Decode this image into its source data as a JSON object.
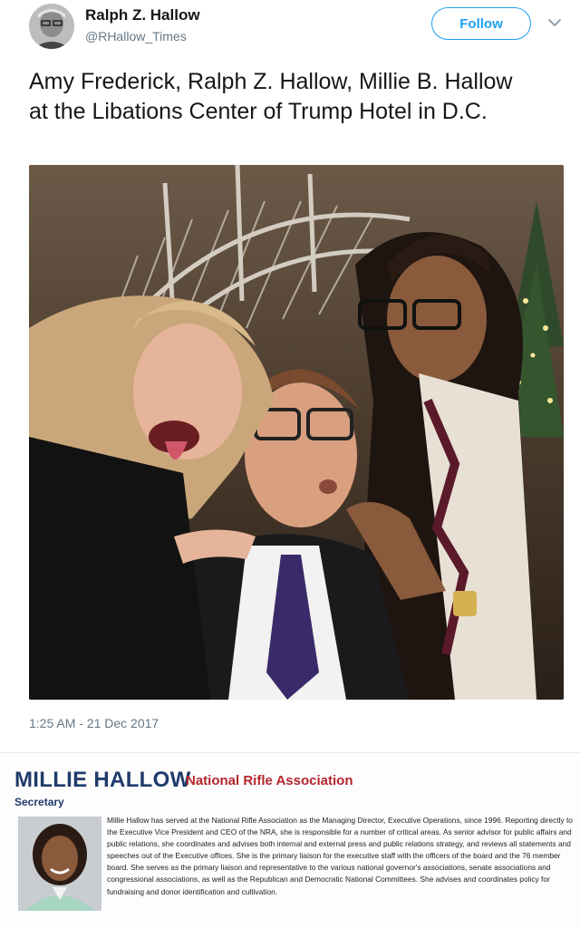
{
  "user": {
    "display_name": "Ralph Z. Hallow",
    "handle": "@RHallow_Times",
    "avatar_icon": "user-avatar"
  },
  "actions": {
    "follow_label": "Follow",
    "menu_icon": "chevron-down-icon"
  },
  "tweet": {
    "text": "Amy Frederick, Ralph Z. Hallow, Millie B. Hallow at the Libations Center of Trump Hotel in D.C.",
    "timestamp": "1:25 AM - 21 Dec 2017"
  },
  "bio": {
    "name": "MILLIE HALLOW",
    "organization": "National Rifle Association",
    "title": "Secretary",
    "text": "Millie Hallow has served at the National Rifle Association as the Managing Director, Executive Operations, since 1996. Reporting directly to the Executive Vice President and CEO of the NRA, she is responsible for a number of critical areas. As senior advisor for public affairs and public relations, she coordinates and advises both internal and external press and public relations strategy, and reviews all statements and speeches out of the Executive offices. She is the primary liaison for the executive staff with the officers of the board and the 76 member board. She serves as the primary liaison and representative to the various national governor's associations, senate associations and congressional associations, as well as the Republican and Democratic National Committees. She advises and coordinates policy for fundraising and donor identification and cultivation."
  },
  "colors": {
    "accent": "#1da1f2",
    "muted_text": "#657786",
    "bio_name": "#1f3b6a",
    "bio_org": "#b3262d"
  }
}
